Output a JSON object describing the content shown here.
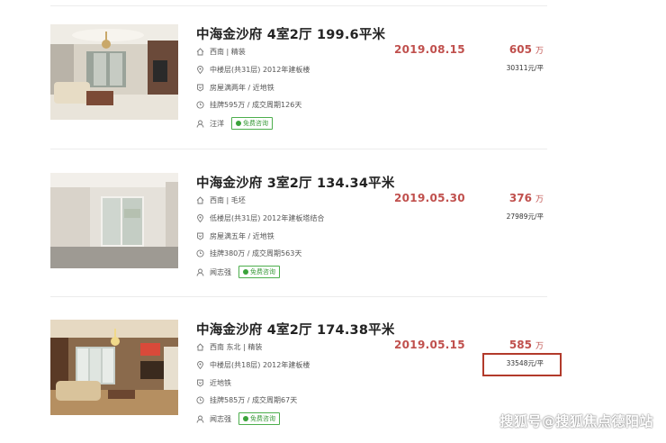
{
  "listings": [
    {
      "title": "中海金沙府 4室2厅 199.6平米",
      "orientation": "西南 | 精装",
      "floor": "中楼层(共31层) 2012年建板楼",
      "tags": "房屋满两年 / 近地铁",
      "listing_info": "挂牌595万 / 成交周期126天",
      "agent": "汪洋",
      "consult_label": "免费咨询",
      "date": "2019.08.15",
      "price": "605",
      "price_unit": "万",
      "unit_price": "30311元/平"
    },
    {
      "title": "中海金沙府 3室2厅 134.34平米",
      "orientation": "西南 | 毛坯",
      "floor": "低楼层(共31层) 2012年建板塔结合",
      "tags": "房屋满五年 / 近地铁",
      "listing_info": "挂牌380万 / 成交周期563天",
      "agent": "闻志强",
      "consult_label": "免费咨询",
      "date": "2019.05.30",
      "price": "376",
      "price_unit": "万",
      "unit_price": "27989元/平"
    },
    {
      "title": "中海金沙府 4室2厅 174.38平米",
      "orientation": "西南 东北 | 精装",
      "floor": "中楼层(共18层) 2012年建板楼",
      "tags": "近地铁",
      "listing_info": "挂牌585万 / 成交周期67天",
      "agent": "闻志强",
      "consult_label": "免费咨询",
      "date": "2019.05.15",
      "price": "585",
      "price_unit": "万",
      "unit_price": "33548元/平"
    }
  ],
  "watermark": "搜狐号@搜狐焦点德阳站",
  "colors": {
    "accent_red": "#c0504d",
    "consult_green": "#3aa33a",
    "highlight_box": "#b23a2b"
  },
  "icons": [
    "home-icon",
    "location-icon",
    "tag-icon",
    "clock-icon",
    "person-icon",
    "chat-icon"
  ]
}
